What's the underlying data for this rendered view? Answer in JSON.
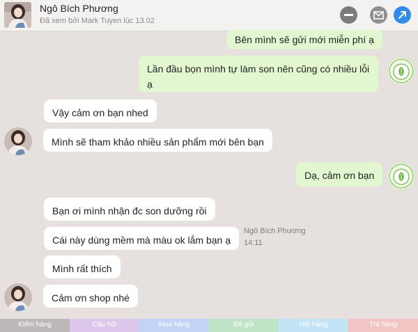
{
  "header": {
    "name": "Ngô Bích Phương",
    "seen_status": "Đã xem bởi Mark Tuyen lúc 13.02",
    "buttons": [
      "minus-icon",
      "mail-icon",
      "arrow-up-right-icon"
    ]
  },
  "messages": [
    {
      "side": "out",
      "text": "Bên mình sẽ gửi mới miễn phí ạ"
    },
    {
      "side": "out",
      "text": "Lần đầu bọn mình tự làm son nên cũng có nhiều lỗi ạ"
    },
    {
      "side": "in",
      "text": "Vậy cảm ơn bạn nhed"
    },
    {
      "side": "in",
      "text": "Mình sẽ tham khảo nhiều sản phẩm mới bên bạn"
    },
    {
      "side": "out",
      "text": "Dạ, cảm ơn bạn"
    },
    {
      "side": "in",
      "text": "Bạn ơi mình nhận đc son dưỡng rồi"
    },
    {
      "side": "in",
      "text": "Cái này dùng mềm mà màu ok lắm bạn ạ"
    },
    {
      "side": "in",
      "text": "Mình rất thích"
    },
    {
      "side": "in",
      "text": "Cảm ơn shop nhé"
    }
  ],
  "sender_info": {
    "name": "Ngô Bích Phương",
    "time": "14:11"
  },
  "tabs": [
    {
      "label": "Kiếm hàng",
      "color": "#bdb7b7"
    },
    {
      "label": "Câu hỏi",
      "color": "#ddc6ec"
    },
    {
      "label": "Mua hàng",
      "color": "#c2d3f5"
    },
    {
      "label": "Đã gửi",
      "color": "#bfe3c7"
    },
    {
      "label": "Hết hàng",
      "color": "#c3e3f7"
    },
    {
      "label": "Trả hàng",
      "color": "#f3c4c4"
    }
  ],
  "colors": {
    "outgoing_bubble": "#e2f6cf",
    "incoming_bubble": "#ffffff",
    "accent": "#2f8de8"
  }
}
